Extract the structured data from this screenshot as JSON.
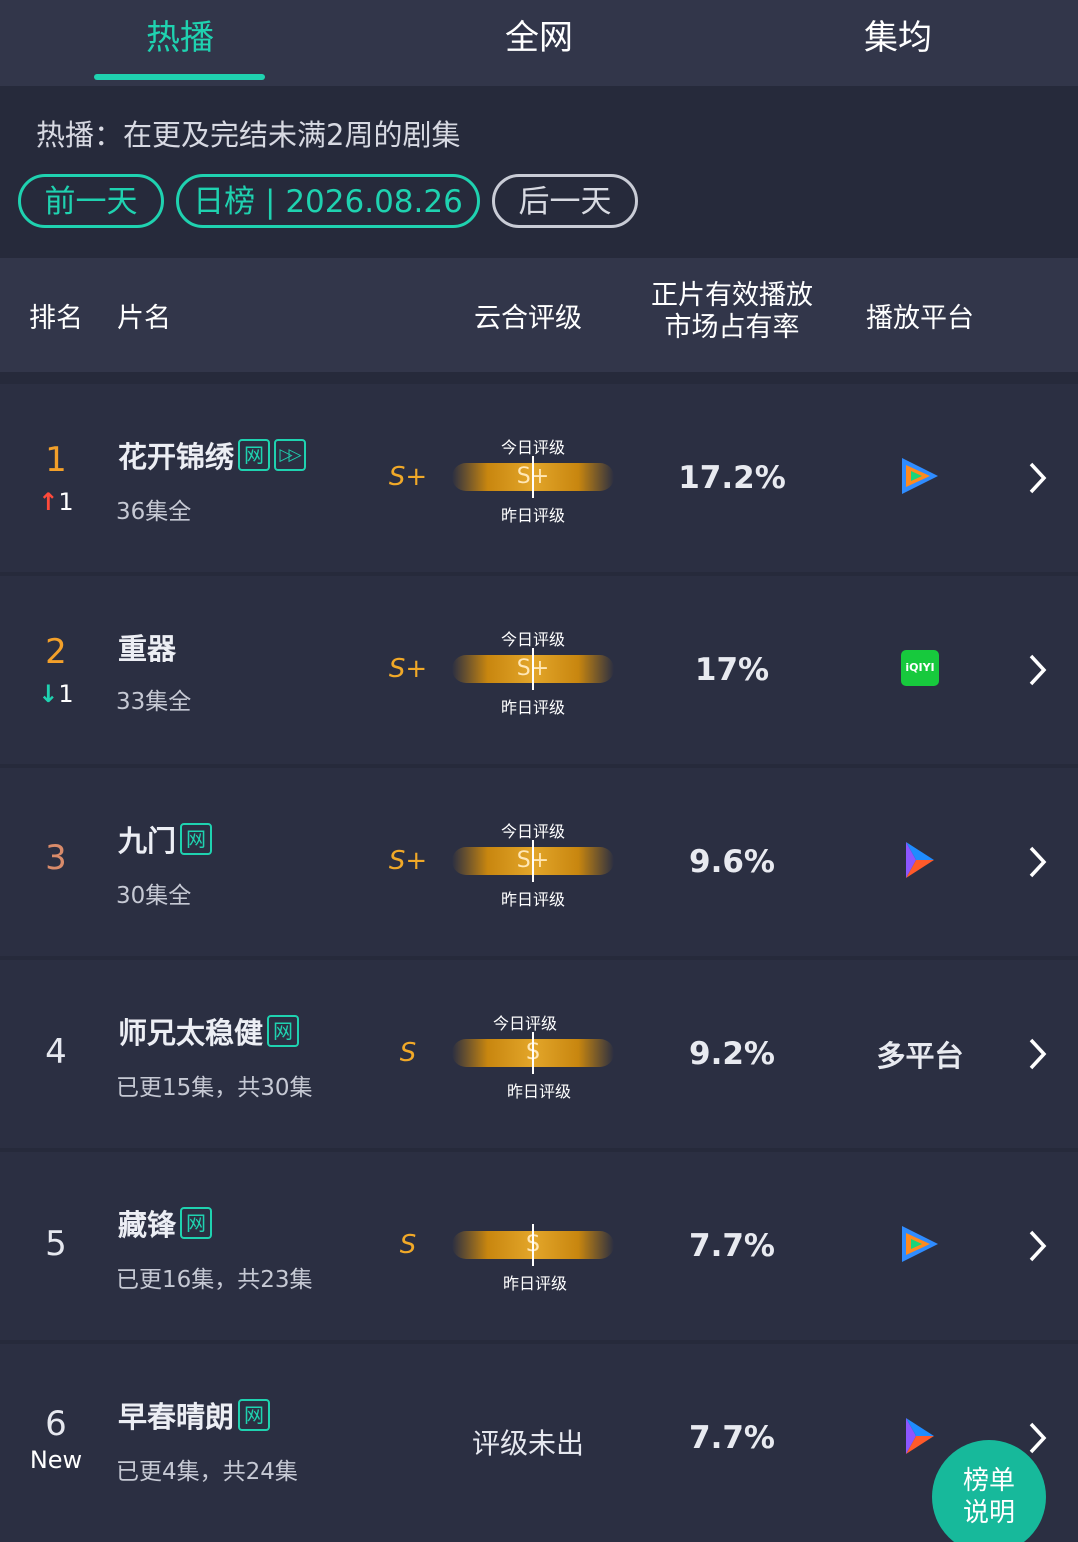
{
  "tabs": [
    {
      "label": "热播",
      "active": true
    },
    {
      "label": "全网",
      "active": false
    },
    {
      "label": "集均",
      "active": false
    }
  ],
  "filter": {
    "description": "热播：在更及完结未满2周的剧集",
    "prev_day": "前一天",
    "current": "日榜 | 2026.08.26",
    "next_day": "后一天"
  },
  "table_header": {
    "rank": "排名",
    "title": "片名",
    "rating": "云合评级",
    "share_line1": "正片有效播放",
    "share_line2": "市场占有率",
    "platform": "播放平台"
  },
  "rating_labels": {
    "today": "今日评级",
    "yesterday": "昨日评级"
  },
  "rows": [
    {
      "rank": "1",
      "change_dir": "up",
      "change": "1",
      "title": "花开锦绣",
      "tags": [
        "网",
        "▷▷"
      ],
      "episodes": "36集全",
      "grade": "S+",
      "bar": "S+",
      "share": "17.2%",
      "platform": "tencent-video"
    },
    {
      "rank": "2",
      "change_dir": "down",
      "change": "1",
      "title": "重器",
      "tags": [],
      "episodes": "33集全",
      "grade": "S+",
      "bar": "S+",
      "share": "17%",
      "platform": "iqiyi",
      "platform_text": "iQIYI"
    },
    {
      "rank": "3",
      "change_dir": "",
      "change": "",
      "title": "九门",
      "tags": [
        "网"
      ],
      "episodes": "30集全",
      "grade": "S+",
      "bar": "S+",
      "share": "9.6%",
      "platform": "youku"
    },
    {
      "rank": "4",
      "change_dir": "",
      "change": "",
      "title": "师兄太稳健",
      "tags": [
        "网"
      ],
      "episodes": "已更15集，共30集",
      "grade": "S",
      "bar": "S",
      "share": "9.2%",
      "platform": "multi",
      "platform_text": "多平台"
    },
    {
      "rank": "5",
      "change_dir": "",
      "change": "",
      "title": "藏锋",
      "tags": [
        "网"
      ],
      "episodes": "已更16集，共23集",
      "grade": "S",
      "bar": "S",
      "share": "7.7%",
      "platform": "tencent-video"
    },
    {
      "rank": "6",
      "change_dir": "new",
      "change": "New",
      "title": "早春晴朗",
      "tags": [
        "网"
      ],
      "episodes": "已更4集，共24集",
      "grade": "",
      "pending": "评级未出",
      "share": "7.7%",
      "platform": "youku"
    }
  ],
  "help_button": {
    "line1": "榜单",
    "line2": "说明"
  },
  "colors": {
    "accent": "#1fd2b0",
    "grade": "#f1a928",
    "up": "#ff4a3b",
    "rank_top": "#f3a02a",
    "rank_third": "#d98b6a"
  }
}
